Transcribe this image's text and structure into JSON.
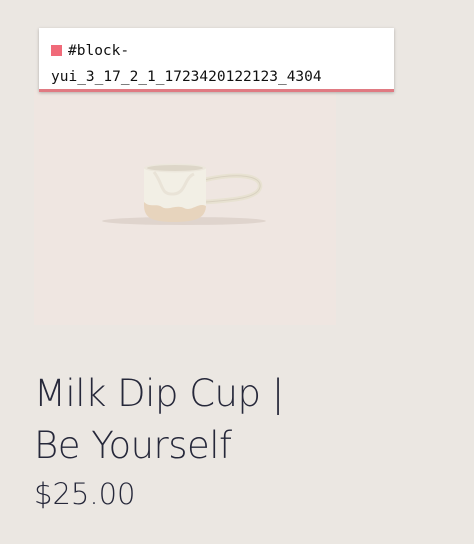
{
  "tooltip": {
    "line1": "#block-",
    "line2": "yui_3_17_2_1_1723420122123_4304",
    "swatch_color": "#f06a79"
  },
  "product": {
    "image_icon": "milk-dip-cup-image",
    "title_line1": "Milk Dip Cup |",
    "title_line2": "Be Yourself",
    "price": "$25.00"
  }
}
